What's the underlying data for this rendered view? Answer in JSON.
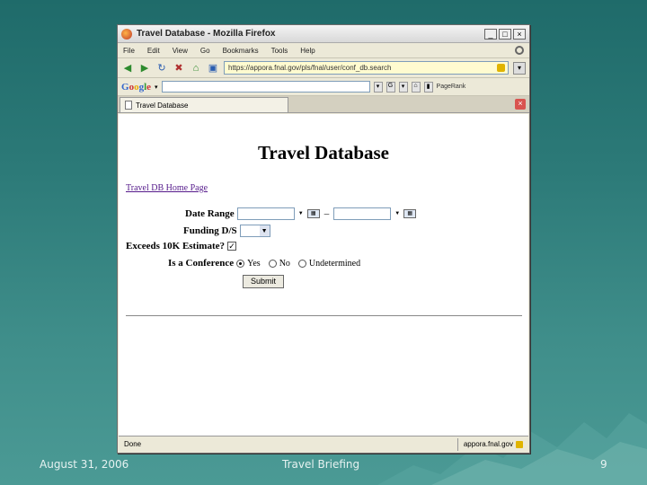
{
  "browser": {
    "window_title": "Travel Database - Mozilla Firefox",
    "window_buttons": [
      "_",
      "□",
      "×"
    ],
    "menu": [
      "File",
      "Edit",
      "View",
      "Go",
      "Bookmarks",
      "Tools",
      "Help"
    ],
    "url": "https://appora.fnal.gov/pls/fnal/user/conf_db.search",
    "toolbar_extras": "PageRank",
    "tab_title": "Travel Database",
    "status_text": "Done",
    "status_host": "appora.fnal.gov",
    "google_label": [
      "G",
      "o",
      "o",
      "g",
      "l",
      "e"
    ]
  },
  "page": {
    "title": "Travel Database",
    "home_link": "Travel DB Home Page",
    "date_range_label": "Date Range",
    "date_separator": "–",
    "funding_label": "Funding D/S",
    "exceeds_label": "Exceeds 10K Estimate?",
    "exceeds_checked": true,
    "conference_label": "Is a Conference",
    "conference_options": [
      "Yes",
      "No",
      "Undetermined"
    ],
    "conference_selected": "Yes",
    "submit_label": "Submit"
  },
  "slide": {
    "date": "August 31, 2006",
    "title": "Travel Briefing",
    "page_number": "9"
  },
  "colors": {
    "background": "#2c7a78",
    "link": "#551a8b"
  }
}
